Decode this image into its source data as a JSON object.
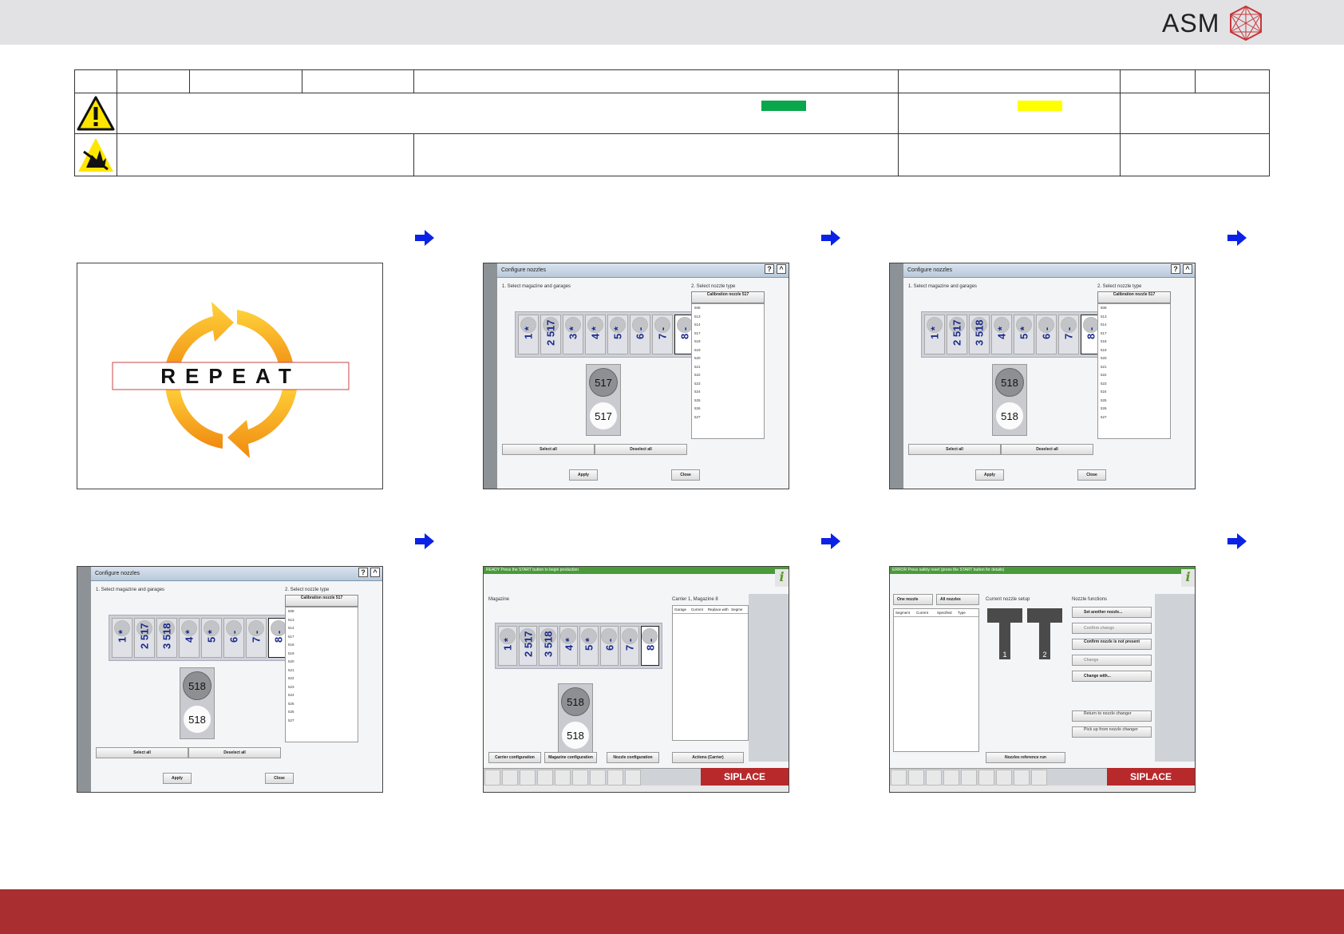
{
  "logo": {
    "text": "ASM"
  },
  "repeat": {
    "text": "REPEAT"
  },
  "colors": {
    "green_swatch": "#0aa64b",
    "yellow_swatch": "#ffff00",
    "bottom_bar": "#a92e30"
  },
  "icons": {
    "warning": "warning-triangle-icon",
    "esd": "esd-hand-icon",
    "arrow": "arrow-right-icon"
  },
  "config": {
    "title": "Configure nozzles",
    "step1": "1. Select magazine and garages",
    "step2": "2. Select nozzle type",
    "calib": "Calibration nozzle 517",
    "select_all": "Select all",
    "deselect_all": "Deselect all",
    "apply": "Apply",
    "close": "Close",
    "types": [
      "508",
      "513",
      "514",
      "517",
      "518",
      "519",
      "520",
      "521",
      "522",
      "523",
      "524",
      "525",
      "526",
      "527"
    ]
  },
  "shot2": {
    "slots": [
      "1 *",
      "2 517",
      "3 *",
      "4 *",
      "5 *",
      "6 -",
      "7 -",
      "8 -"
    ],
    "g1": "517",
    "g2": "517"
  },
  "shot3": {
    "slots": [
      "1 *",
      "2 517",
      "3 518",
      "4 *",
      "5 *",
      "6 -",
      "7 -",
      "8 -"
    ],
    "g1": "518",
    "g2": "518"
  },
  "shot4": {
    "slots": [
      "1 *",
      "2 517",
      "3 518",
      "4 *",
      "5 *",
      "6 -",
      "7 -",
      "8 -"
    ],
    "g1": "518",
    "g2": "518"
  },
  "shot5": {
    "bar": "READY Press the START button to begin production",
    "magazine": "Magazine",
    "carrier": "Carrier 1, Magazine 8",
    "cols": [
      "Garage",
      "Current",
      "Replace with",
      "Segme"
    ],
    "slots": [
      "1 *",
      "2 517",
      "3 518",
      "4 *",
      "5 *",
      "6 -",
      "7 -",
      "8 -"
    ],
    "g1": "518",
    "g2": "518",
    "btn1": "Carrier configuration",
    "btn2": "Magazine configuration",
    "btn3": "Nozzle configuration",
    "btn4": "Actions (Carrier)",
    "siplace": "SIPLACE"
  },
  "shot6": {
    "bar": "ERROR Press safety reset (press the START button for details)",
    "one": "One nozzle",
    "all": "All nozzles",
    "setup": "Current nozzle setup",
    "functions": "Nozzle functions",
    "cols": [
      "Segment",
      "Current",
      "Specified",
      "Type"
    ],
    "f1": "Set another nozzle...",
    "f2": "Confirm change",
    "f3": "Confirm nozzle is not present",
    "f4": "Change",
    "f5": "Change with...",
    "f6": "Return to nozzle changer",
    "f7": "Pick up from nozzle changer",
    "ref": "Nozzles reference run",
    "n1": "1",
    "n2": "2",
    "siplace": "SIPLACE"
  }
}
